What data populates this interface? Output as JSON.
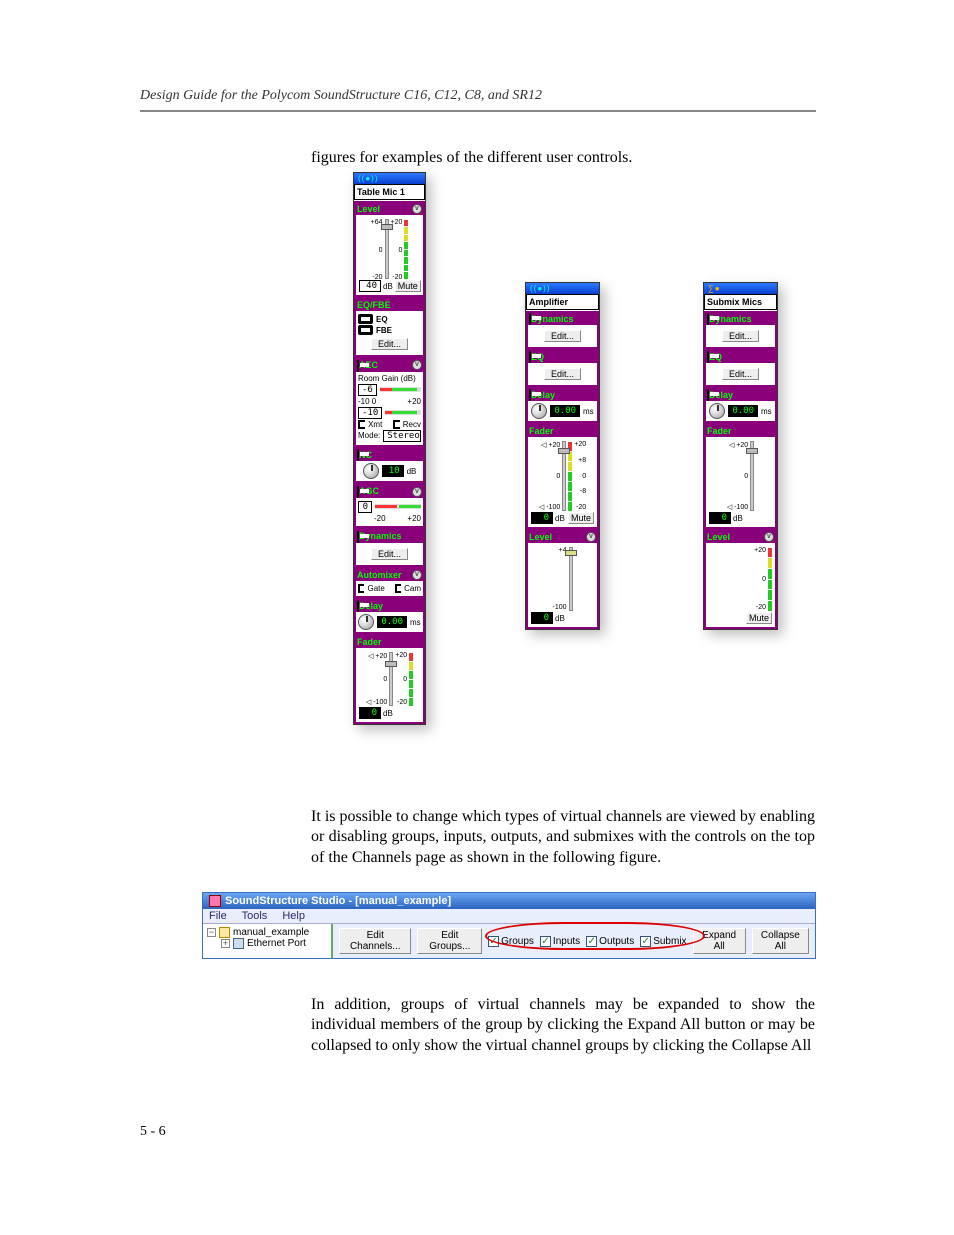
{
  "doc": {
    "header": "Design Guide for the Polycom SoundStructure C16, C12, C8, and SR12",
    "page_number": "5 - 6",
    "p1": "figures for examples of the different user controls.",
    "p2": "It is possible to change which types of virtual channels are viewed by enabling or disabling groups, inputs, outputs, and submixes with the controls on the top of the Channels page as shown in the following figure.",
    "p3": "In addition, groups of virtual channels may be expanded to show the individual members of the group by clicking the Expand All button or may be collapsed to only show the virtual channel groups by clicking the Collapse All"
  },
  "panel1": {
    "channel": "Table Mic 1",
    "level": {
      "title": "Level",
      "ticks": [
        "+64",
        "0",
        "-20",
        "+20",
        "0",
        "-20"
      ],
      "value": "40",
      "unit": "dB",
      "mute": "Mute"
    },
    "eqfbe": {
      "title": "EQ/FBE",
      "eq": "EQ",
      "fbe": "FBE",
      "edit": "Edit..."
    },
    "aec": {
      "title": "AEC",
      "room": "Room Gain (dB)",
      "v1": "-6",
      "v2": "-10",
      "lo": "-10  0",
      "hi": "+20",
      "xmt": "Xmt",
      "recv": "Recv",
      "mode_lbl": "Mode:",
      "mode": "Stereo"
    },
    "nc": {
      "title": "NC",
      "value": "10",
      "unit": "dB"
    },
    "agc": {
      "title": "AGC",
      "value": "0",
      "lo": "-20",
      "hi": "+20"
    },
    "dyn": {
      "title": "Dynamics",
      "edit": "Edit..."
    },
    "am": {
      "title": "Automixer",
      "gate": "Gate",
      "cam": "Cam"
    },
    "delay": {
      "title": "Delay",
      "value": "0.00",
      "unit": "ms"
    },
    "fader": {
      "title": "Fader",
      "ticks_l": [
        "+20",
        "0",
        "-100"
      ],
      "ticks_r": [
        "+20",
        "0",
        "-20"
      ],
      "val": "0",
      "unit": "dB"
    }
  },
  "panel2": {
    "channel": "Amplifier",
    "dyn": {
      "title": "Dynamics",
      "edit": "Edit..."
    },
    "eq": {
      "title": "EQ",
      "edit": "Edit..."
    },
    "delay": {
      "title": "Delay",
      "value": "0.00",
      "unit": "ms"
    },
    "fader": {
      "title": "Fader",
      "ticks_l": [
        "+20",
        "0",
        "-100"
      ],
      "ticks_r": [
        "+20",
        "+8",
        "0",
        "-8",
        "-20"
      ],
      "val": "0",
      "unit": "dB",
      "mute": "Mute"
    },
    "level": {
      "title": "Level",
      "marker": "+4",
      "lo": "-100",
      "val": "0",
      "unit": "dB"
    }
  },
  "panel3": {
    "channel": "Submix Mics",
    "dyn": {
      "title": "Dynamics",
      "edit": "Edit..."
    },
    "eq": {
      "title": "EQ",
      "edit": "Edit..."
    },
    "delay": {
      "title": "Delay",
      "value": "0.00",
      "unit": "ms"
    },
    "fader": {
      "title": "Fader",
      "ticks_l": [
        "+20",
        "0",
        "-100"
      ],
      "val": "0",
      "unit": "dB"
    },
    "level": {
      "title": "Level",
      "ticks_r": [
        "+20",
        "0",
        "-20"
      ],
      "mute": "Mute"
    }
  },
  "appwin": {
    "title": "SoundStructure Studio - [manual_example]",
    "menu": {
      "file": "File",
      "tools": "Tools",
      "help": "Help"
    },
    "tree": {
      "root": "manual_example",
      "child": "Ethernet Port"
    },
    "toolbar": {
      "edit_channels": "Edit Channels...",
      "edit_groups": "Edit Groups...",
      "groups": "Groups",
      "inputs": "Inputs",
      "outputs": "Outputs",
      "submix": "Submix",
      "expand": "Expand All",
      "collapse": "Collapse All"
    }
  }
}
